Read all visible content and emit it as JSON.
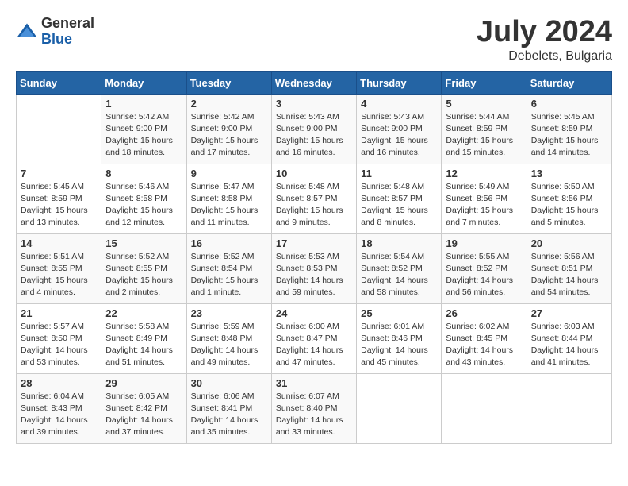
{
  "logo": {
    "general": "General",
    "blue": "Blue"
  },
  "title": "July 2024",
  "subtitle": "Debelets, Bulgaria",
  "days_of_week": [
    "Sunday",
    "Monday",
    "Tuesday",
    "Wednesday",
    "Thursday",
    "Friday",
    "Saturday"
  ],
  "weeks": [
    [
      {
        "day": "",
        "info": ""
      },
      {
        "day": "1",
        "info": "Sunrise: 5:42 AM\nSunset: 9:00 PM\nDaylight: 15 hours\nand 18 minutes."
      },
      {
        "day": "2",
        "info": "Sunrise: 5:42 AM\nSunset: 9:00 PM\nDaylight: 15 hours\nand 17 minutes."
      },
      {
        "day": "3",
        "info": "Sunrise: 5:43 AM\nSunset: 9:00 PM\nDaylight: 15 hours\nand 16 minutes."
      },
      {
        "day": "4",
        "info": "Sunrise: 5:43 AM\nSunset: 9:00 PM\nDaylight: 15 hours\nand 16 minutes."
      },
      {
        "day": "5",
        "info": "Sunrise: 5:44 AM\nSunset: 8:59 PM\nDaylight: 15 hours\nand 15 minutes."
      },
      {
        "day": "6",
        "info": "Sunrise: 5:45 AM\nSunset: 8:59 PM\nDaylight: 15 hours\nand 14 minutes."
      }
    ],
    [
      {
        "day": "7",
        "info": "Sunrise: 5:45 AM\nSunset: 8:59 PM\nDaylight: 15 hours\nand 13 minutes."
      },
      {
        "day": "8",
        "info": "Sunrise: 5:46 AM\nSunset: 8:58 PM\nDaylight: 15 hours\nand 12 minutes."
      },
      {
        "day": "9",
        "info": "Sunrise: 5:47 AM\nSunset: 8:58 PM\nDaylight: 15 hours\nand 11 minutes."
      },
      {
        "day": "10",
        "info": "Sunrise: 5:48 AM\nSunset: 8:57 PM\nDaylight: 15 hours\nand 9 minutes."
      },
      {
        "day": "11",
        "info": "Sunrise: 5:48 AM\nSunset: 8:57 PM\nDaylight: 15 hours\nand 8 minutes."
      },
      {
        "day": "12",
        "info": "Sunrise: 5:49 AM\nSunset: 8:56 PM\nDaylight: 15 hours\nand 7 minutes."
      },
      {
        "day": "13",
        "info": "Sunrise: 5:50 AM\nSunset: 8:56 PM\nDaylight: 15 hours\nand 5 minutes."
      }
    ],
    [
      {
        "day": "14",
        "info": "Sunrise: 5:51 AM\nSunset: 8:55 PM\nDaylight: 15 hours\nand 4 minutes."
      },
      {
        "day": "15",
        "info": "Sunrise: 5:52 AM\nSunset: 8:55 PM\nDaylight: 15 hours\nand 2 minutes."
      },
      {
        "day": "16",
        "info": "Sunrise: 5:52 AM\nSunset: 8:54 PM\nDaylight: 15 hours\nand 1 minute."
      },
      {
        "day": "17",
        "info": "Sunrise: 5:53 AM\nSunset: 8:53 PM\nDaylight: 14 hours\nand 59 minutes."
      },
      {
        "day": "18",
        "info": "Sunrise: 5:54 AM\nSunset: 8:52 PM\nDaylight: 14 hours\nand 58 minutes."
      },
      {
        "day": "19",
        "info": "Sunrise: 5:55 AM\nSunset: 8:52 PM\nDaylight: 14 hours\nand 56 minutes."
      },
      {
        "day": "20",
        "info": "Sunrise: 5:56 AM\nSunset: 8:51 PM\nDaylight: 14 hours\nand 54 minutes."
      }
    ],
    [
      {
        "day": "21",
        "info": "Sunrise: 5:57 AM\nSunset: 8:50 PM\nDaylight: 14 hours\nand 53 minutes."
      },
      {
        "day": "22",
        "info": "Sunrise: 5:58 AM\nSunset: 8:49 PM\nDaylight: 14 hours\nand 51 minutes."
      },
      {
        "day": "23",
        "info": "Sunrise: 5:59 AM\nSunset: 8:48 PM\nDaylight: 14 hours\nand 49 minutes."
      },
      {
        "day": "24",
        "info": "Sunrise: 6:00 AM\nSunset: 8:47 PM\nDaylight: 14 hours\nand 47 minutes."
      },
      {
        "day": "25",
        "info": "Sunrise: 6:01 AM\nSunset: 8:46 PM\nDaylight: 14 hours\nand 45 minutes."
      },
      {
        "day": "26",
        "info": "Sunrise: 6:02 AM\nSunset: 8:45 PM\nDaylight: 14 hours\nand 43 minutes."
      },
      {
        "day": "27",
        "info": "Sunrise: 6:03 AM\nSunset: 8:44 PM\nDaylight: 14 hours\nand 41 minutes."
      }
    ],
    [
      {
        "day": "28",
        "info": "Sunrise: 6:04 AM\nSunset: 8:43 PM\nDaylight: 14 hours\nand 39 minutes."
      },
      {
        "day": "29",
        "info": "Sunrise: 6:05 AM\nSunset: 8:42 PM\nDaylight: 14 hours\nand 37 minutes."
      },
      {
        "day": "30",
        "info": "Sunrise: 6:06 AM\nSunset: 8:41 PM\nDaylight: 14 hours\nand 35 minutes."
      },
      {
        "day": "31",
        "info": "Sunrise: 6:07 AM\nSunset: 8:40 PM\nDaylight: 14 hours\nand 33 minutes."
      },
      {
        "day": "",
        "info": ""
      },
      {
        "day": "",
        "info": ""
      },
      {
        "day": "",
        "info": ""
      }
    ]
  ]
}
